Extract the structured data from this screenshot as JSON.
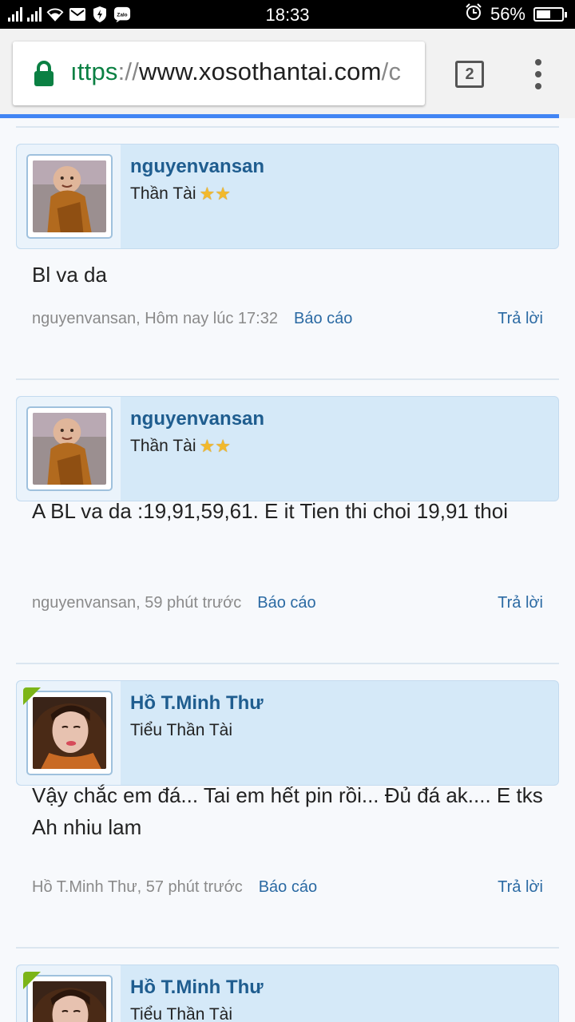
{
  "status_bar": {
    "time": "18:33",
    "battery_percent": "56%",
    "battery_level": 0.56,
    "icons": [
      "signal-icon",
      "signal-icon",
      "wifi-icon",
      "mail-icon",
      "shield-icon",
      "zalo-icon",
      "alarm-icon",
      "battery-icon"
    ],
    "zalo_label": "Zalo"
  },
  "browser": {
    "url_scheme": "ıttps",
    "url_sep": "://",
    "url_host": "www.xosothantai.com",
    "url_rest": "/c",
    "tab_count": "2",
    "lock_color": "#0b8043"
  },
  "posts": [
    {
      "username": "nguyenvansan",
      "rank": "Thần Tài",
      "stars": 2,
      "online": false,
      "message": "Bl va da",
      "meta_author_time": "nguyenvansan, Hôm nay lúc 17:32",
      "report_label": "Báo cáo",
      "reply_label": "Trả lời"
    },
    {
      "username": "nguyenvansan",
      "rank": "Thần Tài",
      "stars": 2,
      "online": false,
      "message": "A BL va da :19,91,59,61. E it Tien thi choi 19,91 thoi",
      "meta_author_time": "nguyenvansan, 59 phút trước",
      "report_label": "Báo cáo",
      "reply_label": "Trả lời"
    },
    {
      "username": "Hồ T.Minh Thư",
      "rank": "Tiểu Thần Tài",
      "stars": 0,
      "online": true,
      "message": "Vậy chắc em đá... Tai em hết pin rồi... Đủ đá ak.... E tks Ah nhiu lam",
      "meta_author_time": "Hồ T.Minh Thư, 57 phút trước",
      "report_label": "Báo cáo",
      "reply_label": "Trả lời"
    },
    {
      "username": "Hồ T.Minh Thư",
      "rank": "Tiểu Thần Tài",
      "stars": 0,
      "online": true
    }
  ]
}
